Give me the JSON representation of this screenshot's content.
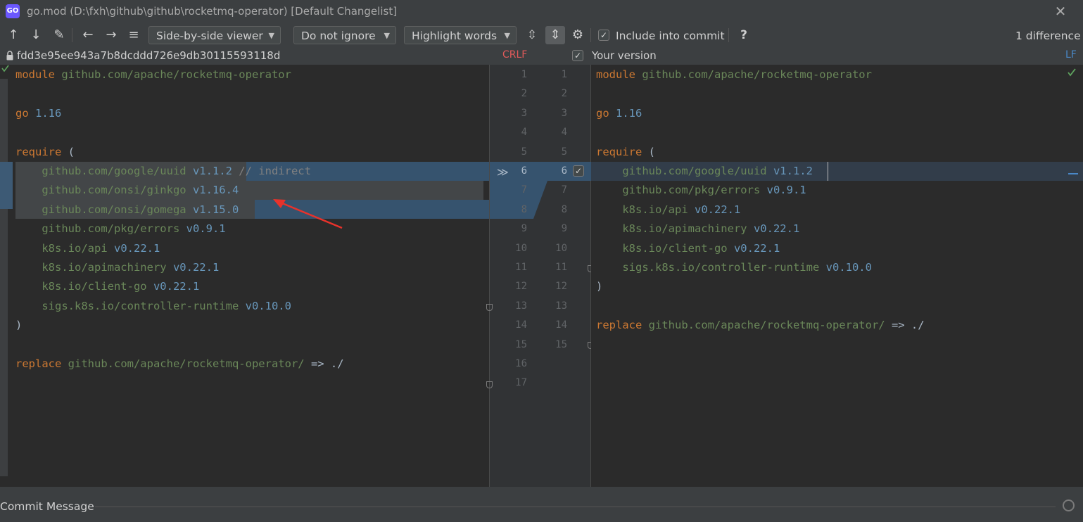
{
  "window": {
    "title": "go.mod (D:\\fxh\\github\\github\\rocketmq-operator) [Default Changelist]",
    "logo_text": "GO"
  },
  "toolbar": {
    "viewer_select": "Side-by-side viewer",
    "ignore_select": "Do not ignore",
    "highlight_select": "Highlight words",
    "include_label": "Include into commit",
    "help": "?",
    "difference_count": "1 difference"
  },
  "infobar": {
    "left_revision": "fdd3e95ee943a7b8dcddd726e9db30115593118d",
    "left_line_separator": "CRLF",
    "right_title": "Your version",
    "right_line_separator": "LF"
  },
  "left_lines": [
    {
      "kw": "module",
      "rest": " ",
      "path": "github.com/apache/rocketmq-operator"
    },
    {
      "kw": "",
      "rest": "",
      "path": ""
    },
    {
      "kw": "go",
      "rest": " ",
      "num": "1.16"
    },
    {
      "kw": "",
      "rest": "",
      "path": ""
    },
    {
      "kw": "require",
      "rest": " ("
    },
    {
      "path": "    github.com/google/uuid",
      "num": " v1.1.2",
      "com": " // indirect"
    },
    {
      "path": "    github.com/onsi/ginkgo",
      "num": " v1.16.4"
    },
    {
      "path": "    github.com/onsi/gomega",
      "num": " v1.15.0"
    },
    {
      "path": "    github.com/pkg/errors",
      "num": " v0.9.1"
    },
    {
      "path": "    k8s.io/api",
      "num": " v0.22.1"
    },
    {
      "path": "    k8s.io/apimachinery",
      "num": " v0.22.1"
    },
    {
      "path": "    k8s.io/client-go",
      "num": " v0.22.1"
    },
    {
      "path": "    sigs.k8s.io/controller-runtime",
      "num": " v0.10.0"
    },
    {
      "plain": ")"
    },
    {
      "plain": ""
    },
    {
      "kw": "replace",
      "path": " github.com/apache/rocketmq-operator/",
      "plain": " => ./"
    }
  ],
  "right_lines": [
    {
      "kw": "module",
      "path": " github.com/apache/rocketmq-operator"
    },
    {
      "plain": ""
    },
    {
      "kw": "go",
      "num": " 1.16"
    },
    {
      "plain": ""
    },
    {
      "kw": "require",
      "plain": " ("
    },
    {
      "path": "    github.com/google/uuid",
      "num": " v1.1.2"
    },
    {
      "path": "    github.com/pkg/errors",
      "num": " v0.9.1"
    },
    {
      "path": "    k8s.io/api",
      "num": " v0.22.1"
    },
    {
      "path": "    k8s.io/apimachinery",
      "num": " v0.22.1"
    },
    {
      "path": "    k8s.io/client-go",
      "num": " v0.22.1"
    },
    {
      "path": "    sigs.k8s.io/controller-runtime",
      "num": " v0.10.0"
    },
    {
      "plain": ")"
    },
    {
      "plain": ""
    },
    {
      "kw": "replace",
      "path": " github.com/apache/rocketmq-operator/",
      "plain": " => ./"
    }
  ],
  "gutter": {
    "left_numbers": [
      "1",
      "2",
      "3",
      "4",
      "5",
      "6",
      "7",
      "8",
      "9",
      "10",
      "11",
      "12",
      "13",
      "14",
      "15",
      "16",
      "17"
    ],
    "right_numbers": [
      "1",
      "2",
      "3",
      "4",
      "5",
      "6",
      "7",
      "8",
      "9",
      "10",
      "11",
      "12",
      "13",
      "14",
      "15"
    ]
  },
  "bottom": {
    "commit_label": "Commit Message"
  },
  "colors": {
    "keyword": "#cc7832",
    "number": "#6897bb",
    "path": "#6a8759",
    "annotation_arrow": "#e8322b"
  }
}
